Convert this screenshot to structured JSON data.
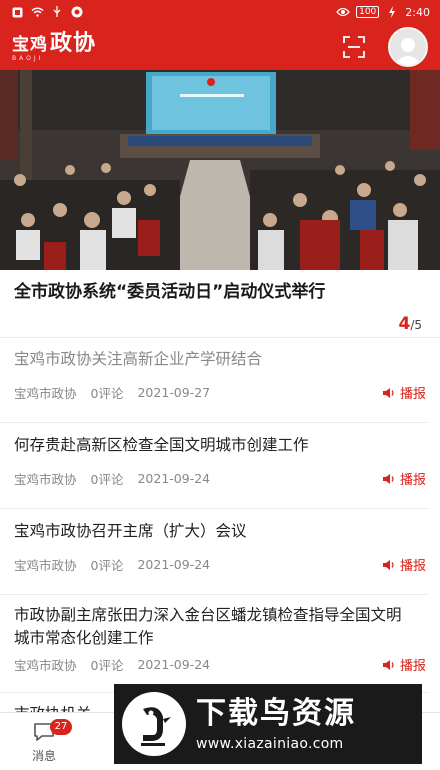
{
  "status_bar": {
    "battery": "100",
    "time": "2:40"
  },
  "header": {
    "brand_city": "宝鸡",
    "brand_org": "政协",
    "brand_sub": "BAOJI"
  },
  "headline": {
    "title": "全市政协系统“委员活动日”启动仪式举行",
    "pager_current": "4",
    "pager_total": "/5"
  },
  "news": [
    {
      "title": "宝鸡市政协关注高新企业产学研结合",
      "source": "宝鸡市政协",
      "comments": "0评论",
      "date": "2021-09-27",
      "play_label": "播报",
      "read": true
    },
    {
      "title": "何存贵赴高新区检查全国文明城市创建工作",
      "source": "宝鸡市政协",
      "comments": "0评论",
      "date": "2021-09-24",
      "play_label": "播报",
      "read": false
    },
    {
      "title": "宝鸡市政协召开主席（扩大）会议",
      "source": "宝鸡市政协",
      "comments": "0评论",
      "date": "2021-09-24",
      "play_label": "播报",
      "read": false
    },
    {
      "title": "市政协副主席张田力深入金台区蟠龙镇检查指导全国文明城市常态化创建工作",
      "source": "宝鸡市政协",
      "comments": "0评论",
      "date": "2021-09-24",
      "play_label": "播报",
      "read": false
    },
    {
      "title": "市政协机关",
      "source": "",
      "comments": "",
      "date": "",
      "play_label": "",
      "read": false
    }
  ],
  "tabbar": {
    "tabs": [
      {
        "label": "消息",
        "badge": "27"
      }
    ]
  },
  "watermark": {
    "title": "下载鸟资源",
    "url": "www.xiazainiao.com"
  },
  "colors": {
    "brand_red": "#d9231d"
  }
}
